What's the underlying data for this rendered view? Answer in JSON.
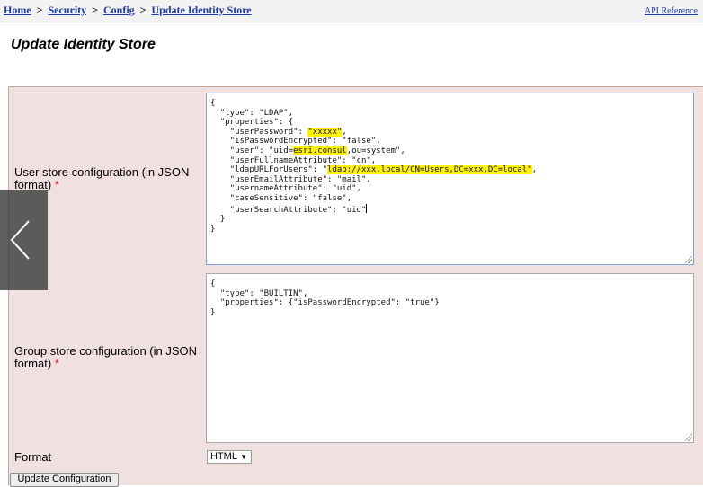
{
  "breadcrumb": {
    "items": [
      "Home",
      "Security",
      "Config",
      "Update Identity Store"
    ],
    "separator": ">"
  },
  "api_reference_label": "API Reference",
  "page_title": "Update Identity Store",
  "form": {
    "user_store_label": "User store configuration (in JSON format)",
    "group_store_label": "Group store configuration (in JSON format)",
    "required_marker": "*",
    "format_label": "Format",
    "format_value": "HTML",
    "submit_label": "Update Configuration"
  },
  "user_store_json": {
    "l0": "{",
    "l1": "  \"type\": \"LDAP\",",
    "l2": "  \"properties\": {",
    "l3a": "    \"userPassword\": ",
    "l3b": "\"xxxxx\"",
    "l3c": ",",
    "l4": "    \"isPasswordEncrypted\": \"false\",",
    "l5a": "    \"user\": \"uid=",
    "l5b": "esri.consul",
    "l5c": ",ou=system\",",
    "l6": "    \"userFullnameAttribute\": \"cn\",",
    "l7a": "    \"ldapURLForUsers\": \"",
    "l7b": "ldap://xxx.local/CN=Users,DC=xxx,DC=local\"",
    "l7c": ",",
    "l8": "    \"userEmailAttribute\": \"mail\",",
    "l9": "    \"usernameAttribute\": \"uid\",",
    "l10": "    \"caseSensitive\": \"false\",",
    "l11": "    \"userSearchAttribute\": \"uid\"",
    "l12": "  }",
    "l13": "}"
  },
  "group_store_json": {
    "l0": "{",
    "l1": "  \"type\": \"BUILTIN\",",
    "l2": "  \"properties\": {\"isPasswordEncrypted\": \"true\"}",
    "l3": "}"
  },
  "icons": {
    "nav_prev": "chevron-left-icon",
    "select_arrow": "triangle-down-icon"
  },
  "colors": {
    "link": "#1d3aa8",
    "panel_bg": "#f1e0e0",
    "highlight": "#fff200",
    "required": "#e02020"
  }
}
